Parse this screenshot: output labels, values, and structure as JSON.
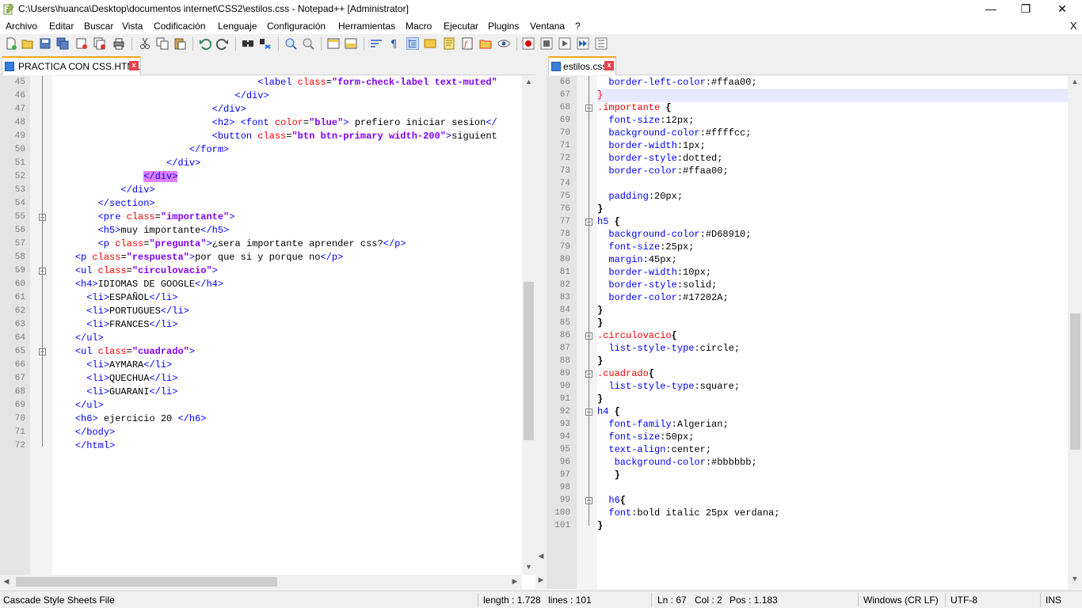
{
  "window": {
    "title": "C:\\Users\\huanca\\Desktop\\documentos internet\\CSS2\\estilos.css - Notepad++ [Administrator]",
    "controls": {
      "minimize": "—",
      "restore": "❐",
      "close": "✕"
    }
  },
  "menu": {
    "items": [
      "Archivo",
      "Editar",
      "Buscar",
      "Vista",
      "Codificación",
      "Lenguaje",
      "Configuración",
      "Herramientas",
      "Macro",
      "Ejecutar",
      "Plugins",
      "Ventana",
      "?"
    ],
    "close": "X"
  },
  "toolbar": {
    "icons": [
      "new-file-icon",
      "open-file-icon",
      "save-icon",
      "save-all-icon",
      "close-icon",
      "close-all-icon",
      "print-icon",
      "cut-icon",
      "copy-icon",
      "paste-icon",
      "undo-icon",
      "redo-icon",
      "find-icon",
      "replace-icon",
      "zoom-in-icon",
      "zoom-out-icon",
      "sync-vertical-icon",
      "sync-horizontal-icon",
      "word-wrap-icon",
      "show-all-chars-icon",
      "indent-guide-icon",
      "user-lang-icon",
      "doc-map-icon",
      "function-list-icon",
      "folder-workspace-icon",
      "monitor-icon",
      "record-macro-icon",
      "stop-macro-icon",
      "play-macro-icon",
      "run-macro-multiple-icon",
      "save-macro-icon"
    ]
  },
  "left_pane": {
    "tab": {
      "label": "PRACTICA CON CSS.HTML",
      "close": "x"
    },
    "first_line": 45,
    "lines": [
      [
        {
          "t": "                                    ",
          "c": "tx"
        },
        {
          "t": "<label ",
          "c": "tg"
        },
        {
          "t": "class",
          "c": "at"
        },
        {
          "t": "=",
          "c": "tx"
        },
        {
          "t": "\"form-check-label text-muted\"",
          "c": "av"
        }
      ],
      [
        {
          "t": "                                ",
          "c": "tx"
        },
        {
          "t": "</div>",
          "c": "tg"
        }
      ],
      [
        {
          "t": "                            ",
          "c": "tx"
        },
        {
          "t": "</div>",
          "c": "tg"
        }
      ],
      [
        {
          "t": "                            ",
          "c": "tx"
        },
        {
          "t": "<h2> <font ",
          "c": "tg"
        },
        {
          "t": "color",
          "c": "at"
        },
        {
          "t": "=",
          "c": "tx"
        },
        {
          "t": "\"blue\"",
          "c": "av"
        },
        {
          "t": "> ",
          "c": "tg"
        },
        {
          "t": "prefiero iniciar sesion",
          "c": "tx"
        },
        {
          "t": "</",
          "c": "tg"
        }
      ],
      [
        {
          "t": "                            ",
          "c": "tx"
        },
        {
          "t": "<button ",
          "c": "tg"
        },
        {
          "t": "class",
          "c": "at"
        },
        {
          "t": "=",
          "c": "tx"
        },
        {
          "t": "\"btn btn-primary width-200\"",
          "c": "av"
        },
        {
          "t": ">",
          "c": "tg"
        },
        {
          "t": "siguient",
          "c": "tx"
        }
      ],
      [
        {
          "t": "                        ",
          "c": "tx"
        },
        {
          "t": "</form>",
          "c": "tg"
        }
      ],
      [
        {
          "t": "                    ",
          "c": "tx"
        },
        {
          "t": "</div>",
          "c": "tg"
        }
      ],
      [
        {
          "t": "                ",
          "c": "tx"
        },
        {
          "t": "</div>",
          "c": "tg hl-tag"
        }
      ],
      [
        {
          "t": "            ",
          "c": "tx"
        },
        {
          "t": "</div>",
          "c": "tg"
        }
      ],
      [
        {
          "t": "        ",
          "c": "tx"
        },
        {
          "t": "</section>",
          "c": "tg"
        }
      ],
      [
        {
          "t": "        ",
          "c": "tx"
        },
        {
          "t": "<pre ",
          "c": "tg"
        },
        {
          "t": "class",
          "c": "at"
        },
        {
          "t": "=",
          "c": "tx"
        },
        {
          "t": "\"importante\"",
          "c": "av"
        },
        {
          "t": ">",
          "c": "tg"
        }
      ],
      [
        {
          "t": "        ",
          "c": "tx"
        },
        {
          "t": "<h5>",
          "c": "tg"
        },
        {
          "t": "muy importante",
          "c": "tx"
        },
        {
          "t": "</h5>",
          "c": "tg"
        }
      ],
      [
        {
          "t": "        ",
          "c": "tx"
        },
        {
          "t": "<p ",
          "c": "tg"
        },
        {
          "t": "class",
          "c": "at"
        },
        {
          "t": "=",
          "c": "tx"
        },
        {
          "t": "\"pregunta\"",
          "c": "av"
        },
        {
          "t": ">",
          "c": "tg"
        },
        {
          "t": "¿sera importante aprender css?",
          "c": "tx"
        },
        {
          "t": "</p>",
          "c": "tg"
        }
      ],
      [
        {
          "t": "    ",
          "c": "tx"
        },
        {
          "t": "<p ",
          "c": "tg"
        },
        {
          "t": "class",
          "c": "at"
        },
        {
          "t": "=",
          "c": "tx"
        },
        {
          "t": "\"respuesta\"",
          "c": "av"
        },
        {
          "t": ">",
          "c": "tg"
        },
        {
          "t": "por que si y porque no",
          "c": "tx"
        },
        {
          "t": "</p>",
          "c": "tg"
        }
      ],
      [
        {
          "t": "    ",
          "c": "tx"
        },
        {
          "t": "<ul ",
          "c": "tg"
        },
        {
          "t": "class",
          "c": "at"
        },
        {
          "t": "=",
          "c": "tx"
        },
        {
          "t": "\"circulovacio\"",
          "c": "av"
        },
        {
          "t": ">",
          "c": "tg"
        }
      ],
      [
        {
          "t": "    ",
          "c": "tx"
        },
        {
          "t": "<h4>",
          "c": "tg"
        },
        {
          "t": "IDIOMAS DE GOOGLE",
          "c": "tx"
        },
        {
          "t": "</h4>",
          "c": "tg"
        }
      ],
      [
        {
          "t": "      ",
          "c": "tx"
        },
        {
          "t": "<li>",
          "c": "tg"
        },
        {
          "t": "ESPAÑOL",
          "c": "tx"
        },
        {
          "t": "</li>",
          "c": "tg"
        }
      ],
      [
        {
          "t": "      ",
          "c": "tx"
        },
        {
          "t": "<li>",
          "c": "tg"
        },
        {
          "t": "PORTUGUES",
          "c": "tx"
        },
        {
          "t": "</li>",
          "c": "tg"
        }
      ],
      [
        {
          "t": "      ",
          "c": "tx"
        },
        {
          "t": "<li>",
          "c": "tg"
        },
        {
          "t": "FRANCES",
          "c": "tx"
        },
        {
          "t": "</li>",
          "c": "tg"
        }
      ],
      [
        {
          "t": "    ",
          "c": "tx"
        },
        {
          "t": "</ul>",
          "c": "tg"
        }
      ],
      [
        {
          "t": "    ",
          "c": "tx"
        },
        {
          "t": "<ul ",
          "c": "tg"
        },
        {
          "t": "class",
          "c": "at"
        },
        {
          "t": "=",
          "c": "tx"
        },
        {
          "t": "\"cuadrado\"",
          "c": "av"
        },
        {
          "t": ">",
          "c": "tg"
        }
      ],
      [
        {
          "t": "      ",
          "c": "tx"
        },
        {
          "t": "<li>",
          "c": "tg"
        },
        {
          "t": "AYMARA",
          "c": "tx"
        },
        {
          "t": "</li>",
          "c": "tg"
        }
      ],
      [
        {
          "t": "      ",
          "c": "tx"
        },
        {
          "t": "<li>",
          "c": "tg"
        },
        {
          "t": "QUECHUA",
          "c": "tx"
        },
        {
          "t": "</li>",
          "c": "tg"
        }
      ],
      [
        {
          "t": "      ",
          "c": "tx"
        },
        {
          "t": "<li>",
          "c": "tg"
        },
        {
          "t": "GUARANI",
          "c": "tx"
        },
        {
          "t": "</li>",
          "c": "tg"
        }
      ],
      [
        {
          "t": "    ",
          "c": "tx"
        },
        {
          "t": "</ul>",
          "c": "tg"
        }
      ],
      [
        {
          "t": "    ",
          "c": "tx"
        },
        {
          "t": "<h6> ",
          "c": "tg"
        },
        {
          "t": "ejercicio 20 ",
          "c": "tx"
        },
        {
          "t": "</h6>",
          "c": "tg"
        }
      ],
      [
        {
          "t": "    ",
          "c": "tx"
        },
        {
          "t": "</body>",
          "c": "tg"
        }
      ],
      [
        {
          "t": "    ",
          "c": "tx"
        },
        {
          "t": "</html>",
          "c": "tg"
        }
      ]
    ],
    "folds": [
      55,
      59,
      65
    ]
  },
  "right_pane": {
    "tab": {
      "label": "estilos.css",
      "close": "x"
    },
    "first_line": 66,
    "cursor_line": 67,
    "lines": [
      [
        {
          "t": "  ",
          "c": "tx"
        },
        {
          "t": "border-left-color",
          "c": "pr"
        },
        {
          "t": ":",
          "c": "vl"
        },
        {
          "t": "#ffaa00;",
          "c": "vl"
        }
      ],
      [
        {
          "t": "}",
          "c": "at"
        }
      ],
      [
        {
          "t": ".importante ",
          "c": "at"
        },
        {
          "t": "{",
          "c": "sel"
        }
      ],
      [
        {
          "t": "  ",
          "c": "tx"
        },
        {
          "t": "font-size",
          "c": "pr"
        },
        {
          "t": ":",
          "c": "vl"
        },
        {
          "t": "12px;",
          "c": "vl"
        }
      ],
      [
        {
          "t": "  ",
          "c": "tx"
        },
        {
          "t": "background-color",
          "c": "pr"
        },
        {
          "t": ":",
          "c": "vl"
        },
        {
          "t": "#ffffcc;",
          "c": "vl"
        }
      ],
      [
        {
          "t": "  ",
          "c": "tx"
        },
        {
          "t": "border-width",
          "c": "pr"
        },
        {
          "t": ":",
          "c": "vl"
        },
        {
          "t": "1px;",
          "c": "vl"
        }
      ],
      [
        {
          "t": "  ",
          "c": "tx"
        },
        {
          "t": "border-style",
          "c": "pr"
        },
        {
          "t": ":",
          "c": "vl"
        },
        {
          "t": "dotted;",
          "c": "vl"
        }
      ],
      [
        {
          "t": "  ",
          "c": "tx"
        },
        {
          "t": "border-color",
          "c": "pr"
        },
        {
          "t": ":",
          "c": "vl"
        },
        {
          "t": "#ffaa00;",
          "c": "vl"
        }
      ],
      [
        {
          "t": "",
          "c": "tx"
        }
      ],
      [
        {
          "t": "  ",
          "c": "tx"
        },
        {
          "t": "padding",
          "c": "pr"
        },
        {
          "t": ":",
          "c": "vl"
        },
        {
          "t": "20px;",
          "c": "vl"
        }
      ],
      [
        {
          "t": "}",
          "c": "sel"
        }
      ],
      [
        {
          "t": "h5 ",
          "c": "pr"
        },
        {
          "t": "{",
          "c": "sel"
        }
      ],
      [
        {
          "t": "  ",
          "c": "tx"
        },
        {
          "t": "background-color",
          "c": "pr"
        },
        {
          "t": ":",
          "c": "vl"
        },
        {
          "t": "#D68910;",
          "c": "vl"
        }
      ],
      [
        {
          "t": "  ",
          "c": "tx"
        },
        {
          "t": "font-size",
          "c": "pr"
        },
        {
          "t": ":",
          "c": "vl"
        },
        {
          "t": "25px;",
          "c": "vl"
        }
      ],
      [
        {
          "t": "  ",
          "c": "tx"
        },
        {
          "t": "margin",
          "c": "pr"
        },
        {
          "t": ":",
          "c": "vl"
        },
        {
          "t": "45px;",
          "c": "vl"
        }
      ],
      [
        {
          "t": "  ",
          "c": "tx"
        },
        {
          "t": "border-width",
          "c": "pr"
        },
        {
          "t": ":",
          "c": "vl"
        },
        {
          "t": "10px;",
          "c": "vl"
        }
      ],
      [
        {
          "t": "  ",
          "c": "tx"
        },
        {
          "t": "border-style",
          "c": "pr"
        },
        {
          "t": ":",
          "c": "vl"
        },
        {
          "t": "solid;",
          "c": "vl"
        }
      ],
      [
        {
          "t": "  ",
          "c": "tx"
        },
        {
          "t": "border-color",
          "c": "pr"
        },
        {
          "t": ":",
          "c": "vl"
        },
        {
          "t": "#17202A;",
          "c": "vl"
        }
      ],
      [
        {
          "t": "}",
          "c": "sel"
        }
      ],
      [
        {
          "t": "}",
          "c": "sel"
        }
      ],
      [
        {
          "t": ".circulovacio",
          "c": "at"
        },
        {
          "t": "{",
          "c": "sel"
        }
      ],
      [
        {
          "t": "  ",
          "c": "tx"
        },
        {
          "t": "list-style-type",
          "c": "pr"
        },
        {
          "t": ":",
          "c": "vl"
        },
        {
          "t": "circle;",
          "c": "vl"
        }
      ],
      [
        {
          "t": "}",
          "c": "sel"
        }
      ],
      [
        {
          "t": ".cuadrado",
          "c": "at"
        },
        {
          "t": "{",
          "c": "sel"
        }
      ],
      [
        {
          "t": "  ",
          "c": "tx"
        },
        {
          "t": "list-style-type",
          "c": "pr"
        },
        {
          "t": ":",
          "c": "vl"
        },
        {
          "t": "square;",
          "c": "vl"
        }
      ],
      [
        {
          "t": "}",
          "c": "sel"
        }
      ],
      [
        {
          "t": "h4 ",
          "c": "pr"
        },
        {
          "t": "{",
          "c": "sel"
        }
      ],
      [
        {
          "t": "  ",
          "c": "tx"
        },
        {
          "t": "font-family",
          "c": "pr"
        },
        {
          "t": ":",
          "c": "vl"
        },
        {
          "t": "Algerian;",
          "c": "vl"
        }
      ],
      [
        {
          "t": "  ",
          "c": "tx"
        },
        {
          "t": "font-size",
          "c": "pr"
        },
        {
          "t": ":",
          "c": "vl"
        },
        {
          "t": "50px;",
          "c": "vl"
        }
      ],
      [
        {
          "t": "  ",
          "c": "tx"
        },
        {
          "t": "text-align",
          "c": "pr"
        },
        {
          "t": ":",
          "c": "vl"
        },
        {
          "t": "center;",
          "c": "vl"
        }
      ],
      [
        {
          "t": "   ",
          "c": "tx"
        },
        {
          "t": "background-color",
          "c": "pr"
        },
        {
          "t": ":",
          "c": "vl"
        },
        {
          "t": "#bbbbbb;",
          "c": "vl"
        }
      ],
      [
        {
          "t": "   ",
          "c": "tx"
        },
        {
          "t": "}",
          "c": "sel"
        }
      ],
      [
        {
          "t": "",
          "c": "tx"
        }
      ],
      [
        {
          "t": "  ",
          "c": "tx"
        },
        {
          "t": "h6",
          "c": "pr"
        },
        {
          "t": "{",
          "c": "sel"
        }
      ],
      [
        {
          "t": "  ",
          "c": "tx"
        },
        {
          "t": "font",
          "c": "pr"
        },
        {
          "t": ":",
          "c": "vl"
        },
        {
          "t": "bold italic 25px verdana;",
          "c": "vl"
        }
      ],
      [
        {
          "t": "}",
          "c": "sel"
        }
      ]
    ],
    "folds": [
      68,
      77,
      86,
      89,
      92,
      99
    ]
  },
  "status": {
    "file_type": "Cascade Style Sheets File",
    "length": "length : 1.728",
    "lines": "lines : 101",
    "ln": "Ln : 67",
    "col": "Col : 2",
    "pos": "Pos : 1.183",
    "eol": "Windows (CR LF)",
    "encoding": "UTF-8",
    "mode": "INS"
  },
  "colors": {
    "tag": "#0000ff",
    "attribute": "#ff0000",
    "attr_value": "#8000ff",
    "tab_accent": "#f5a623",
    "cursor_line": "#e8e8ff"
  }
}
